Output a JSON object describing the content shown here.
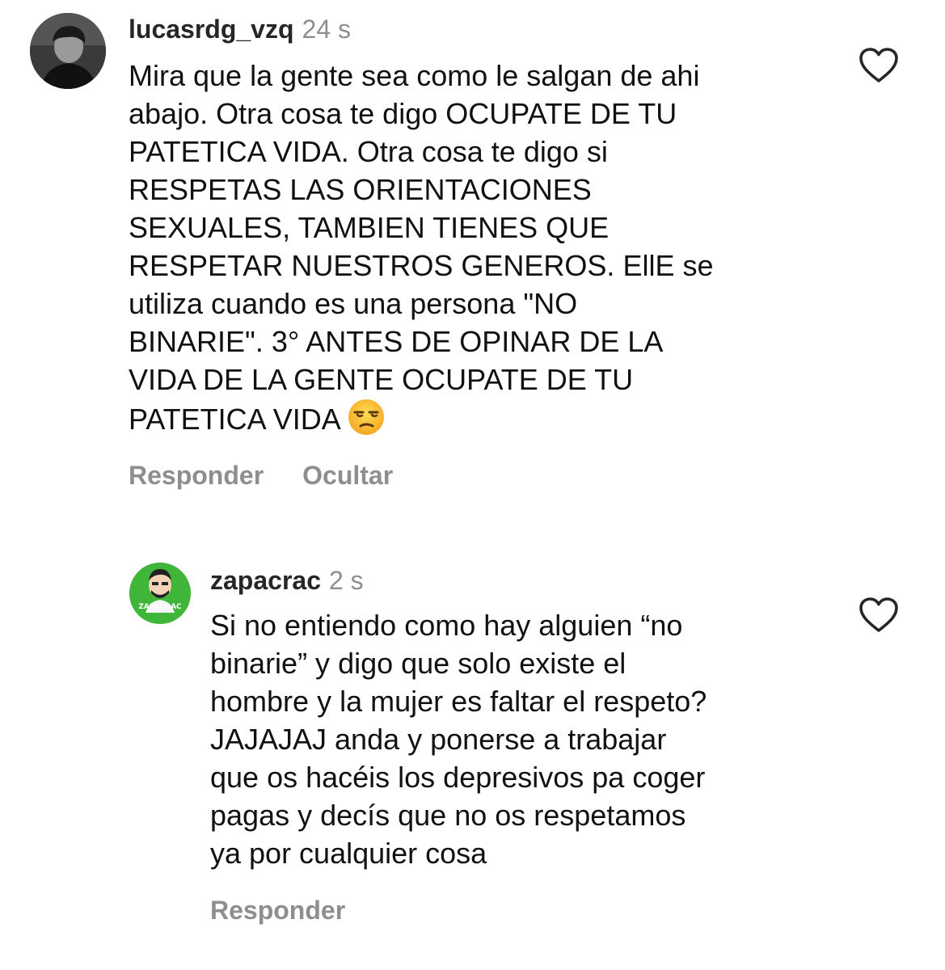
{
  "comments": [
    {
      "username": "lucasrdg_vzq",
      "time": "24 s",
      "lines": [
        "Mira que la gente sea como le salgan de ahi",
        "abajo. Otra cosa te digo OCUPATE DE TU",
        "PATETICA VIDA. Otra cosa te digo si",
        "RESPETAS LAS ORIENTACIONES",
        "SEXUALES, TAMBIEN TIENES QUE",
        "RESPETAR NUESTROS GENEROS. EllE se",
        "utiliza cuando es una persona \"NO",
        "BINARIE\". 3° ANTES DE OPINAR DE LA",
        "VIDA DE LA GENTE OCUPATE DE TU",
        "PATETICA VIDA"
      ],
      "emoji": "unamused-face-emoji",
      "actions": {
        "reply": "Responder",
        "hide": "Ocultar"
      },
      "icons": {
        "like": "heart-outline-icon",
        "avatar": "profile-photo"
      }
    },
    {
      "username": "zapacrac",
      "time": "2 s",
      "avatar_text": "ZAPACRAC",
      "lines": [
        "Si no entiendo como hay alguien “no",
        "binarie” y digo que solo existe el",
        "hombre y la mujer es faltar el respeto?",
        "JAJAJAJ anda y ponerse a trabajar",
        "que os hacéis los depresivos pa coger",
        "pagas y decís que no os respetamos",
        "ya por cualquier cosa"
      ],
      "actions": {
        "reply": "Responder"
      },
      "icons": {
        "like": "heart-outline-icon",
        "avatar": "cartoon-avatar"
      }
    }
  ],
  "colors": {
    "text": "#111111",
    "muted": "#8e8e8e",
    "username": "#262626",
    "avatar2_bg": "#3fb63a"
  }
}
